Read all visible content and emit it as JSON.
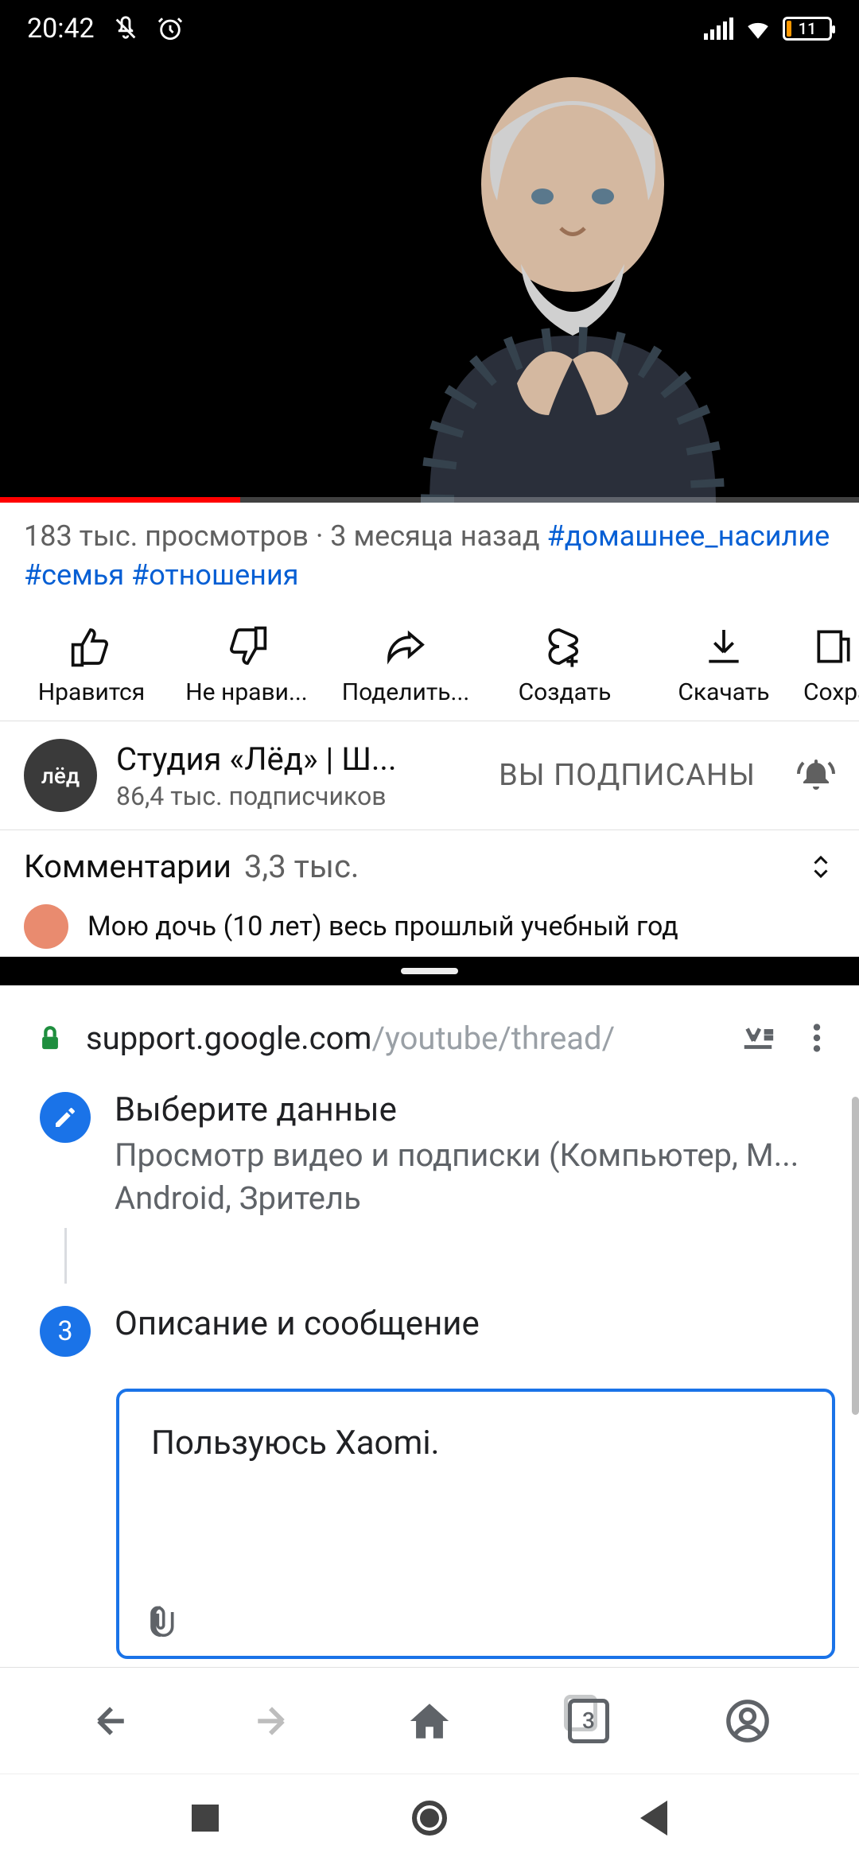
{
  "statusbar": {
    "time": "20:42",
    "battery_pct": "11"
  },
  "video": {
    "meta_views": "183 тыс. просмотров",
    "meta_sep": " · ",
    "meta_age": "3 месяца назад ",
    "tag1": "#домашнее_насилие",
    "tag2": "#семья",
    "tag3": "#отношения",
    "progress_pct": 28
  },
  "actions": {
    "like": "Нравится",
    "dislike": "Не нрави...",
    "share": "Поделить...",
    "create": "Создать",
    "download": "Скачать",
    "save": "Сохра"
  },
  "channel": {
    "avatar_text": "лёд",
    "name": "Студия «Лёд» | Ш...",
    "subs": "86,4 тыс. подписчиков",
    "subscribed": "ВЫ ПОДПИСАНЫ"
  },
  "comments": {
    "title": "Комментарии",
    "count": "3,3 тыс.",
    "preview": "Мою дочь (10 лет) весь прошлый учебный год"
  },
  "browser": {
    "host": "support.google.com",
    "path": "/youtube/thread/",
    "step2_title": "Выберите данные",
    "step2_desc_l1": "Просмотр видео и подписки (Компьютер, М...",
    "step2_desc_l2": "Android, Зритель",
    "step3_num": "3",
    "step3_title": "Описание и сообщение",
    "message_text": "Пользуюсь Xaomi.",
    "tab_count": "3"
  }
}
